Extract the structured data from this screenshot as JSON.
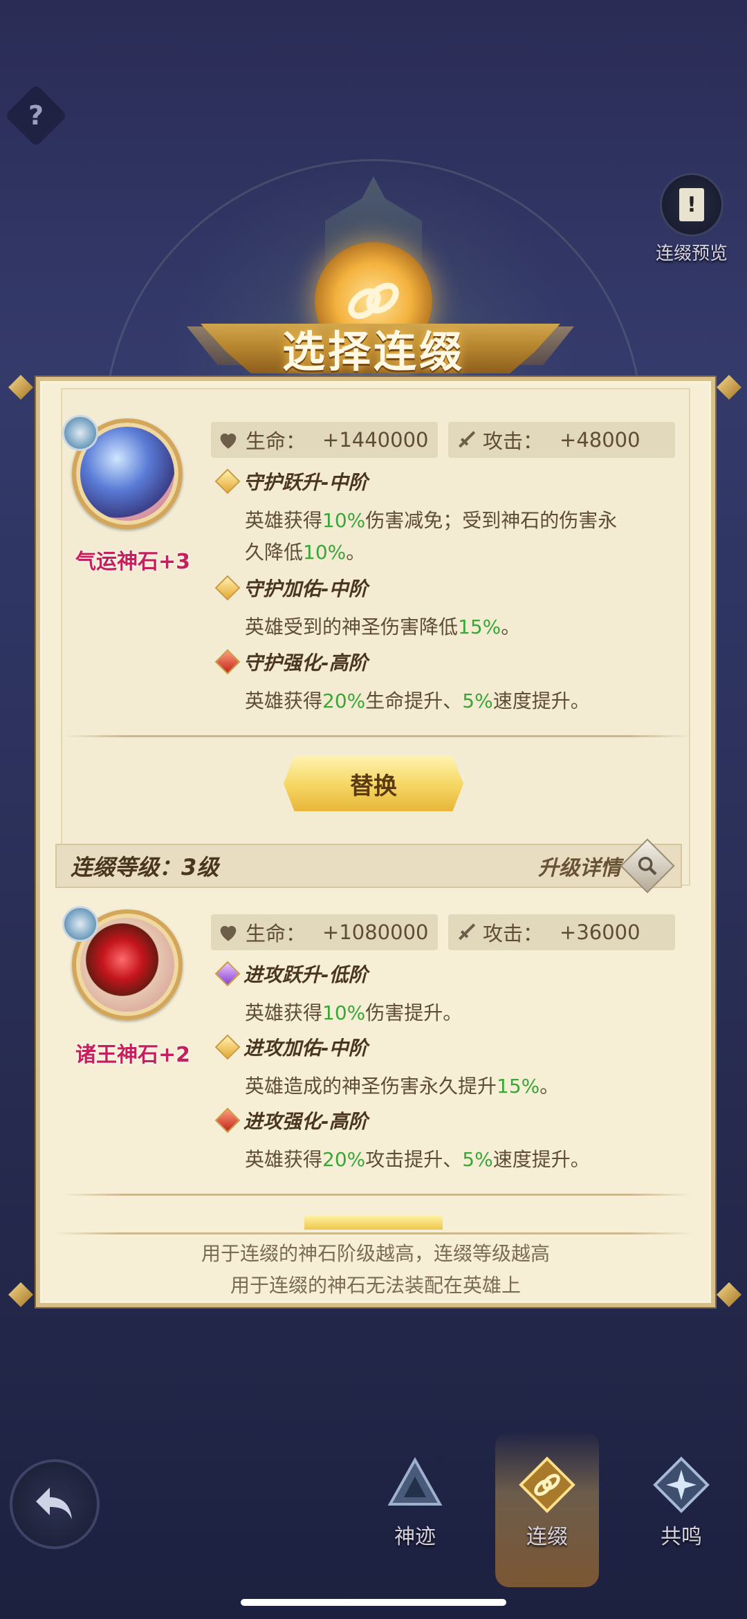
{
  "top": {
    "help_glyph": "?",
    "preview_label": "连缀预览",
    "preview_glyph": "!"
  },
  "title": "选择连缀",
  "current_slot": {
    "gem_name": "气运神石+3",
    "gem_icon": "blue-gem-icon",
    "hp_label": "生命：",
    "hp_value": "+1440000",
    "atk_label": "攻击：",
    "atk_value": "+48000",
    "skills": [
      {
        "tier": "gold",
        "title": "守护跃升-中阶",
        "desc_parts": [
          "英雄获得",
          "10%",
          "伤害减免；受到神石的伤害永",
          "久降低",
          "10%",
          "。"
        ]
      },
      {
        "tier": "gold",
        "title": "守护加佑-中阶",
        "desc_parts": [
          "英雄受到的神圣伤害降低",
          "15%",
          "。"
        ]
      },
      {
        "tier": "red",
        "title": "守护强化-高阶",
        "desc_parts": [
          "英雄获得",
          "20%",
          "生命提升、",
          "5%",
          "速度提升。"
        ]
      }
    ],
    "replace_label": "替换"
  },
  "level_bar": {
    "level_text": "连缀等级：3级",
    "upgrade_label": "升级详情"
  },
  "second_slot": {
    "gem_name": "诸王神石+2",
    "gem_icon": "red-gem-icon",
    "hp_label": "生命：",
    "hp_value": "+1080000",
    "atk_label": "攻击：",
    "atk_value": "+36000",
    "skills": [
      {
        "tier": "purple",
        "title": "进攻跃升-低阶",
        "desc_parts": [
          "英雄获得",
          "10%",
          "伤害提升。"
        ]
      },
      {
        "tier": "gold",
        "title": "进攻加佑-中阶",
        "desc_parts": [
          "英雄造成的神圣伤害永久提升",
          "15%",
          "。"
        ]
      },
      {
        "tier": "red",
        "title": "进攻强化-高阶",
        "desc_parts": [
          "英雄获得",
          "20%",
          "攻击提升、",
          "5%",
          "速度提升。"
        ]
      }
    ]
  },
  "footer": {
    "line1": "用于连缀的神石阶级越高，连缀等级越高",
    "line2": "用于连缀的神石无法装配在英雄上"
  },
  "nav": {
    "items": [
      {
        "label": "神迹",
        "icon": "triangle-emblem-icon",
        "active": false
      },
      {
        "label": "连缀",
        "icon": "chain-emblem-icon",
        "active": true
      },
      {
        "label": "共鸣",
        "icon": "star-emblem-icon",
        "active": false
      }
    ],
    "back_icon": "back-arrow-icon"
  },
  "colors": {
    "highlight_green": "#3aa638",
    "gem_name_pink": "#c6205a",
    "panel_bg": "#f6efd6",
    "gold": "#e8b63a"
  }
}
